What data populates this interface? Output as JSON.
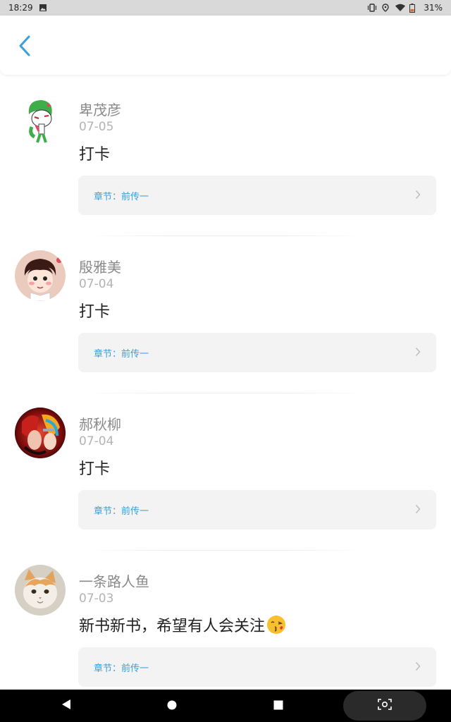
{
  "status_bar": {
    "time": "18:29",
    "battery": "31%",
    "icons": [
      "image-icon",
      "vibrate-icon",
      "location-icon",
      "wifi-icon",
      "battery-icon"
    ]
  },
  "header": {
    "back_icon": "chevron-left-icon"
  },
  "colors": {
    "accent": "#3a9fd8",
    "name_gray": "#8a8a8a",
    "date_gray": "#b3b3b3",
    "card_bg": "#f3f3f3"
  },
  "comments": [
    {
      "name": "卑茂彦",
      "date": "07-05",
      "text": "打卡",
      "chapter": "章节：前传一",
      "avatar": "gardevoir-avatar"
    },
    {
      "name": "殷雅美",
      "date": "07-04",
      "text": "打卡",
      "chapter": "章节：前传一",
      "avatar": "cartoon-boy-avatar"
    },
    {
      "name": "郝秋柳",
      "date": "07-04",
      "text": "打卡",
      "chapter": "章节：前传一",
      "avatar": "anime-avatar"
    },
    {
      "name": "一条路人鱼",
      "date": "07-03",
      "text": "新书新书，希望有人会关注",
      "emoji": "kissing-face-emoji",
      "chapter": "章节：前传一",
      "avatar": "kitten-avatar"
    }
  ],
  "nav_bar": {
    "buttons": [
      "back-triangle-icon",
      "home-circle-icon",
      "recents-square-icon",
      "screenshot-icon"
    ]
  }
}
